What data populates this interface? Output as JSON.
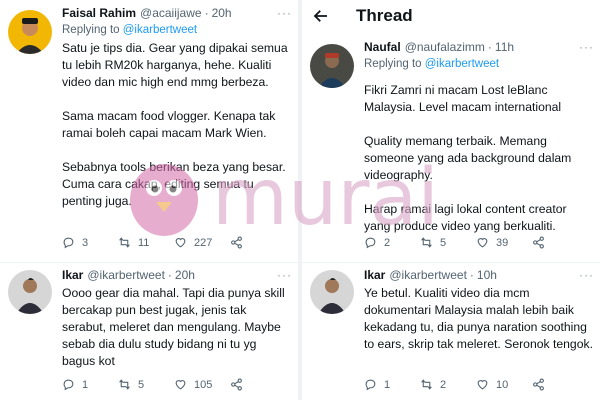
{
  "left_panel": {
    "tweets": [
      {
        "name": "Faisal Rahim",
        "handle": "@acaiijawe",
        "time": "20h",
        "replying_prefix": "Replying to",
        "replying_mention": "@ikarbertweet",
        "text": "Satu je tips dia. Gear yang dipakai semua tu lebih RM20k harganya, hehe. Kualiti video dan mic high end mmg berbeza.\n\nSama macam food vlogger. Kenapa tak ramai boleh capai macam Mark Wien.\n\nSebabnya tools berikan beza yang besar. Cuma cara cakap, editing semua tu penting juga.",
        "replies": "3",
        "retweets": "11",
        "likes": "227"
      },
      {
        "name": "Ikar",
        "handle": "@ikarbertweet",
        "time": "20h",
        "text": "Oooo gear dia mahal. Tapi dia punya skill bercakap pun best jugak, jenis tak serabut, meleret dan mengulang. Maybe sebab dia dulu study bidang ni tu yg bagus kot",
        "replies": "1",
        "retweets": "5",
        "likes": "105"
      }
    ]
  },
  "right_panel": {
    "header_title": "Thread",
    "tweets": [
      {
        "name": "Naufal",
        "handle": "@naufalazimm",
        "time": "11h",
        "replying_prefix": "Replying to",
        "replying_mention": "@ikarbertweet",
        "text": "Fikri Zamri ni macam Lost leBlanc Malaysia. Level macam international\n\nQuality memang terbaik. Memang someone yang ada background dalam videography.\n\nHarap ramai lagi lokal content creator yang produce video yang berkualiti.",
        "replies": "2",
        "retweets": "5",
        "likes": "39"
      },
      {
        "name": "Ikar",
        "handle": "@ikarbertweet",
        "time": "10h",
        "text": "Ye betul. Kualiti video dia mcm dokumentari Malaysia malah lebih baik kekadang tu, dia punya naration soothing to ears, skrip tak meleret. Seronok tengok.",
        "replies": "1",
        "retweets": "2",
        "likes": "10"
      }
    ]
  },
  "watermark": {
    "text": "murai",
    "color": "#d9a4c6"
  },
  "colors": {
    "link": "#1d9bf0",
    "muted": "#536471",
    "divider": "#eff3f4"
  }
}
